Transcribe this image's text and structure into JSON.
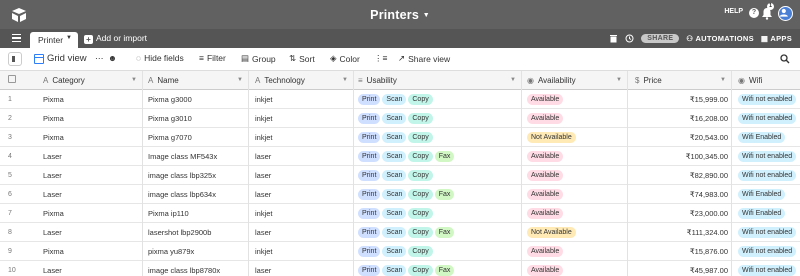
{
  "topbar": {
    "title": "Printers",
    "help_label": "HELP",
    "notification_count": "1"
  },
  "tabbar": {
    "active_tab": "Printer",
    "add_import_label": "Add or import",
    "share_label": "SHARE",
    "automations_label": "AUTOMATIONS",
    "apps_label": "APPS"
  },
  "toolbar": {
    "view_name": "Grid view",
    "hide_fields": "Hide fields",
    "filter": "Filter",
    "group": "Group",
    "sort": "Sort",
    "color": "Color",
    "share_view": "Share view"
  },
  "columns": {
    "category": "Category",
    "name": "Name",
    "technology": "Technology",
    "usability": "Usability",
    "availability": "Availability",
    "price": "Price",
    "wifi": "Wifi"
  },
  "rows": [
    {
      "num": "1",
      "category": "Pixma",
      "name": "Pixma g3000",
      "technology": "inkjet",
      "usability": [
        "Print",
        "Scan",
        "Copy"
      ],
      "availability": "Available",
      "price": "₹15,999.00",
      "wifi": "Wifi not enabled"
    },
    {
      "num": "2",
      "category": "Pixma",
      "name": "Pixma g3010",
      "technology": "inkjet",
      "usability": [
        "Print",
        "Scan",
        "Copy"
      ],
      "availability": "Available",
      "price": "₹16,208.00",
      "wifi": "Wifi not enabled"
    },
    {
      "num": "3",
      "category": "Pixma",
      "name": "Pixma g7070",
      "technology": "inkjet",
      "usability": [
        "Print",
        "Scan",
        "Copy"
      ],
      "availability": "Not Available",
      "price": "₹20,543.00",
      "wifi": "Wifi Enabled"
    },
    {
      "num": "4",
      "category": "Laser",
      "name": "Image class MF543x",
      "technology": "laser",
      "usability": [
        "Print",
        "Scan",
        "Copy",
        "Fax"
      ],
      "availability": "Available",
      "price": "₹100,345.00",
      "wifi": "Wifi not enabled"
    },
    {
      "num": "5",
      "category": "Laser",
      "name": "image class lbp325x",
      "technology": "laser",
      "usability": [
        "Print",
        "Scan",
        "Copy"
      ],
      "availability": "Available",
      "price": "₹82,890.00",
      "wifi": "Wifi not enabled"
    },
    {
      "num": "6",
      "category": "Laser",
      "name": "image class lbp634x",
      "technology": "laser",
      "usability": [
        "Print",
        "Scan",
        "Copy",
        "Fax"
      ],
      "availability": "Available",
      "price": "₹74,983.00",
      "wifi": "Wifi Enabled"
    },
    {
      "num": "7",
      "category": "Pixma",
      "name": "Pixma ip110",
      "technology": "inkjet",
      "usability": [
        "Print",
        "Scan",
        "Copy"
      ],
      "availability": "Available",
      "price": "₹23,000.00",
      "wifi": "Wifi Enabled"
    },
    {
      "num": "8",
      "category": "Laser",
      "name": "lasershot lbp2900b",
      "technology": "laser",
      "usability": [
        "Print",
        "Scan",
        "Copy",
        "Fax"
      ],
      "availability": "Not Available",
      "price": "₹111,324.00",
      "wifi": "Wifi not enabled"
    },
    {
      "num": "9",
      "category": "Pixma",
      "name": "pixma yu879x",
      "technology": "inkjet",
      "usability": [
        "Print",
        "Scan",
        "Copy"
      ],
      "availability": "Available",
      "price": "₹15,876.00",
      "wifi": "Wifi not enabled"
    },
    {
      "num": "10",
      "category": "Laser",
      "name": "image class lbp8780x",
      "technology": "laser",
      "usability": [
        "Print",
        "Scan",
        "Copy",
        "Fax"
      ],
      "availability": "Available",
      "price": "₹45,987.00",
      "wifi": "Wifi not enabled"
    }
  ]
}
